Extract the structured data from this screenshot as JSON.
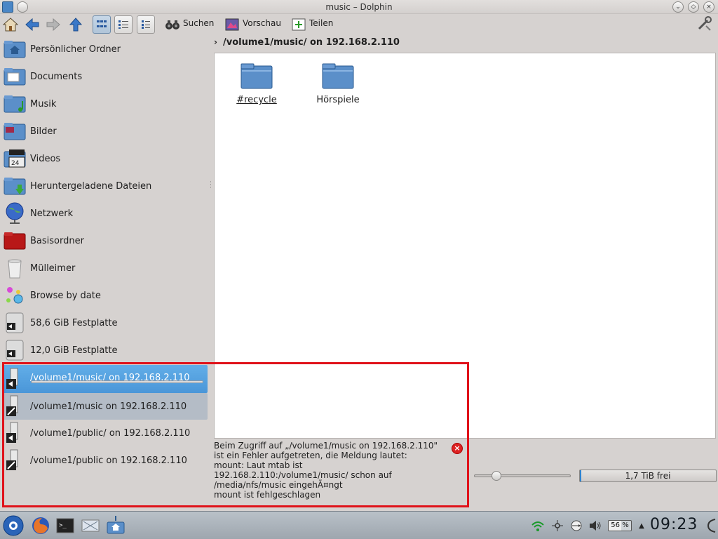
{
  "window": {
    "title": "music – Dolphin"
  },
  "toolbar": {
    "search_label": "Suchen",
    "preview_label": "Vorschau",
    "split_label": "Teilen"
  },
  "places": [
    {
      "label": "Persönlicher Ordner",
      "icon": "home-folder-icon"
    },
    {
      "label": "Documents",
      "icon": "documents-folder-icon"
    },
    {
      "label": "Musik",
      "icon": "music-folder-icon"
    },
    {
      "label": "Bilder",
      "icon": "pictures-folder-icon"
    },
    {
      "label": "Videos",
      "icon": "videos-folder-icon"
    },
    {
      "label": "Heruntergeladene Dateien",
      "icon": "downloads-folder-icon"
    },
    {
      "label": "Netzwerk",
      "icon": "network-globe-icon"
    },
    {
      "label": "Basisordner",
      "icon": "root-folder-icon"
    },
    {
      "label": "Mülleimer",
      "icon": "trash-icon"
    },
    {
      "label": "Browse by date",
      "icon": "timeline-icon"
    },
    {
      "label": "58,6 GiB Festplatte",
      "icon": "hard-disk-icon"
    },
    {
      "label": "12,0 GiB Festplatte",
      "icon": "hard-disk-icon"
    },
    {
      "label": "/volume1/music/ on 192.168.2.110",
      "icon": "nfs-mount-icon",
      "selected": true
    },
    {
      "label": "/volume1/music on 192.168.2.110",
      "icon": "nfs-mount-icon"
    },
    {
      "label": "/volume1/public/ on 192.168.2.110",
      "icon": "nfs-mount-icon"
    },
    {
      "label": "/volume1/public on 192.168.2.110",
      "icon": "nfs-mount-icon"
    }
  ],
  "breadcrumb": {
    "path": "/volume1/music/ on 192.168.2.110"
  },
  "files": [
    {
      "name": "#recycle"
    },
    {
      "name": "Hörspiele"
    }
  ],
  "error": {
    "message": "Beim Zugriff auf „/volume1/music on 192.168.2.110\"\nist ein Fehler aufgetreten, die Meldung lautet:\nmount: Laut mtab ist\n192.168.2.110:/volume1/music/ schon auf\n/media/nfs/music eingehÃ¤ngt\nmount ist fehlgeschlagen"
  },
  "statusbar": {
    "free_space": "1,7 TiB frei",
    "free_fraction": 0.01,
    "zoom_fraction": 0.2
  },
  "taskbar": {
    "battery": "56 %",
    "clock": "09:23"
  },
  "colors": {
    "selection": "#4a96d8",
    "highlight_box": "#e0121a",
    "folder": "#5b8fc9"
  }
}
